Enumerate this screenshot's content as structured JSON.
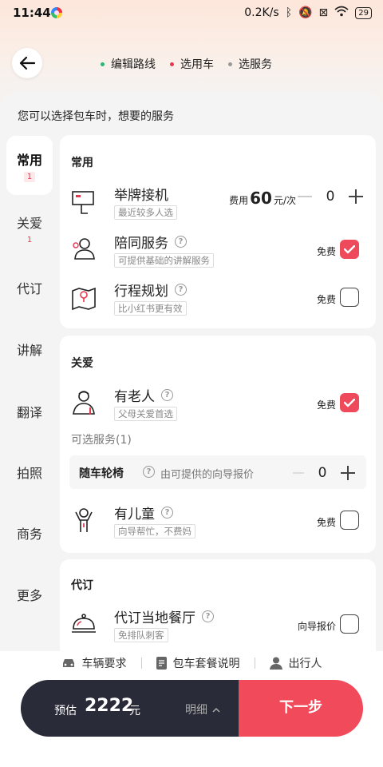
{
  "status": {
    "time": "11:44",
    "speed": "0.2K/s",
    "battery": "29"
  },
  "steps": [
    {
      "label": "编辑路线",
      "color": "#2bb673"
    },
    {
      "label": "选用车",
      "color": "#e8384f"
    },
    {
      "label": "选服务",
      "color": "#999999"
    }
  ],
  "sheet_title": "您可以选择包车时，想要的服务",
  "sidebar": [
    {
      "label": "常用",
      "badge": "1"
    },
    {
      "label": "关爱",
      "badge": "1"
    },
    {
      "label": "代订"
    },
    {
      "label": "讲解"
    },
    {
      "label": "翻译"
    },
    {
      "label": "拍照"
    },
    {
      "label": "商务"
    },
    {
      "label": "更多"
    }
  ],
  "sections": {
    "common": {
      "title": "常用",
      "items": [
        {
          "name": "举牌接机",
          "tag": "最近较多人选",
          "price_prefix": "费用",
          "price": "60",
          "price_unit": "元/次",
          "count": "0"
        },
        {
          "name": "陪同服务",
          "tag": "可提供基础的讲解服务",
          "fee": "免费",
          "checked": true
        },
        {
          "name": "行程规划",
          "tag": "比小红书更有效",
          "fee": "免费",
          "checked": false
        }
      ]
    },
    "care": {
      "title": "关爱",
      "items": [
        {
          "name": "有老人",
          "tag": "父母关爱首选",
          "fee": "免费",
          "checked": true
        },
        {
          "name": "有儿童",
          "tag": "向导帮忙，不费妈",
          "fee": "免费",
          "checked": false
        }
      ],
      "optional_label": "可选服务(1)",
      "optional": {
        "name": "随车轮椅",
        "desc": "由可提供的向导报价",
        "count": "0"
      }
    },
    "booking": {
      "title": "代订",
      "items": [
        {
          "name": "代订当地餐厅",
          "tag": "免排队刺客",
          "fee": "向导报价",
          "checked": false
        }
      ]
    }
  },
  "bottom_links": [
    "车辆要求",
    "包车套餐说明",
    "出行人"
  ],
  "footer": {
    "estimate_label": "预估",
    "amount": "2222",
    "unit": "元",
    "detail": "明细",
    "next": "下一步"
  },
  "colors": {
    "accent": "#ef4a5c",
    "dark": "#2a2b38"
  }
}
